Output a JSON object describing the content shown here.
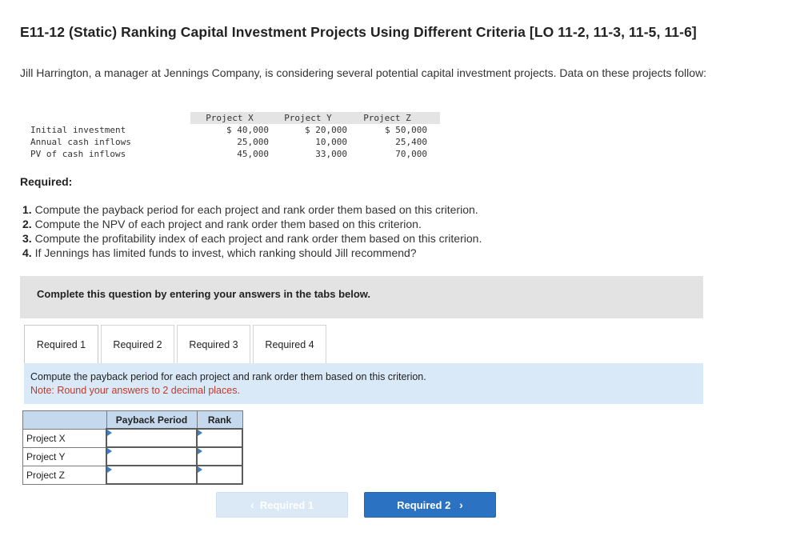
{
  "title": "E11-12 (Static) Ranking Capital Investment Projects Using Different Criteria [LO 11-2, 11-3, 11-5, 11-6]",
  "intro": "Jill Harrington, a manager at Jennings Company, is considering several potential capital investment projects. Data on these projects follow:",
  "data_table": {
    "headers": [
      "Project X",
      "Project Y",
      "Project Z"
    ],
    "rows": [
      {
        "label": "Initial investment",
        "values": [
          "$ 40,000",
          "$ 20,000",
          "$ 50,000"
        ]
      },
      {
        "label": "Annual cash inflows",
        "values": [
          "25,000",
          "10,000",
          "25,400"
        ]
      },
      {
        "label": "PV of cash inflows",
        "values": [
          "45,000",
          "33,000",
          "70,000"
        ]
      }
    ]
  },
  "required_heading": "Required:",
  "requirements": [
    {
      "num": "1.",
      "text": "Compute the payback period for each project and rank order them based on this criterion."
    },
    {
      "num": "2.",
      "text": "Compute the NPV of each project and rank order them based on this criterion."
    },
    {
      "num": "3.",
      "text": "Compute the profitability index of each project and rank order them based on this criterion."
    },
    {
      "num": "4.",
      "text": "If Jennings has limited funds to invest, which ranking should Jill recommend?"
    }
  ],
  "banner": "Complete this question by entering your answers in the tabs below.",
  "tabs": [
    "Required 1",
    "Required 2",
    "Required 3",
    "Required 4"
  ],
  "active_tab": "Required 1",
  "task": {
    "question": "Compute the payback period for each project and rank order them based on this criterion.",
    "note": "Note: Round your answers to 2 decimal places."
  },
  "answer_table": {
    "headers": [
      "",
      "Payback Period",
      "Rank"
    ],
    "rows": [
      "Project X",
      "Project Y",
      "Project Z"
    ]
  },
  "nav": {
    "prev_label": "Required 1",
    "next_label": "Required 2"
  },
  "colors": {
    "accent": "#2b73c2",
    "task_bg": "#d9e9f7",
    "note_red": "#c0392b",
    "header_blue": "#c5d9ee"
  }
}
